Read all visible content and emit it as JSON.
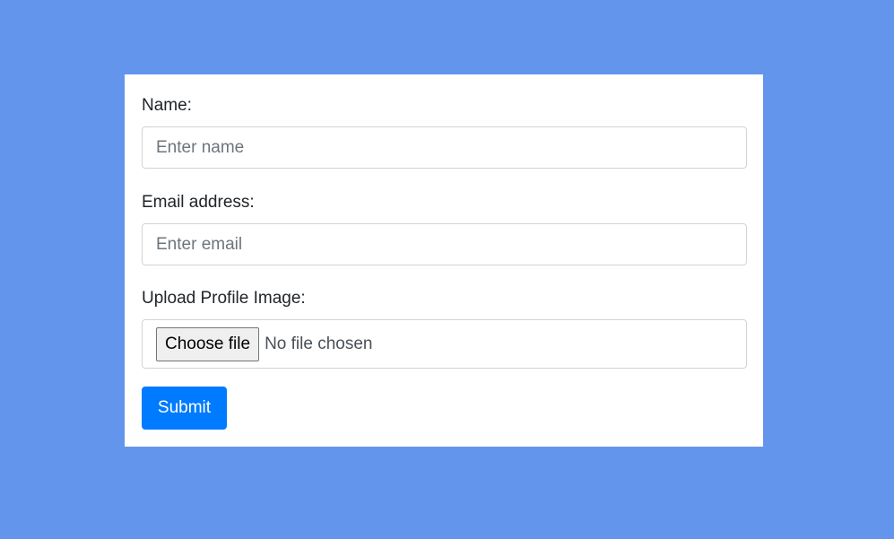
{
  "colors": {
    "background": "#6495ED",
    "card": "#ffffff",
    "primary": "#007bff",
    "text": "#212529",
    "placeholder": "#6c757d",
    "border": "#ced4da"
  },
  "form": {
    "name": {
      "label": "Name:",
      "value": "",
      "placeholder": "Enter name"
    },
    "email": {
      "label": "Email address:",
      "value": "",
      "placeholder": "Enter email"
    },
    "profile_image": {
      "label": "Upload Profile Image:",
      "button_label": "Choose file",
      "status": "No file chosen"
    },
    "submit_label": "Submit"
  }
}
